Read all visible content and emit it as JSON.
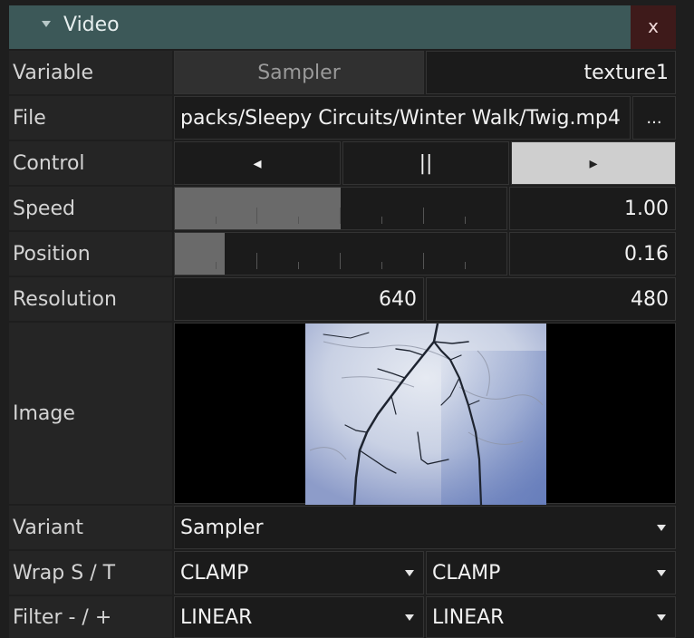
{
  "panel": {
    "title": "Video",
    "close_label": "x"
  },
  "rows": {
    "variable": {
      "label": "Variable",
      "sampler_button": "Sampler",
      "value": "texture1"
    },
    "file": {
      "label": "File",
      "path": "packs/Sleepy Circuits/Winter Walk/Twig.mp4",
      "browse_label": "..."
    },
    "control": {
      "label": "Control",
      "prev": "◂",
      "pause": "||",
      "play": "▸",
      "active": "play"
    },
    "speed": {
      "label": "Speed",
      "value": "1.00",
      "fill_fraction": 0.5
    },
    "position": {
      "label": "Position",
      "value": "0.16",
      "fill_fraction": 0.15
    },
    "resolution": {
      "label": "Resolution",
      "width": "640",
      "height": "480"
    },
    "image": {
      "label": "Image"
    },
    "variant": {
      "label": "Variant",
      "value": "Sampler"
    },
    "wrap": {
      "label": "Wrap S / T",
      "s": "CLAMP",
      "t": "CLAMP"
    },
    "filter": {
      "label": "Filter - / +",
      "min": "LINEAR",
      "mag": "LINEAR"
    }
  },
  "colors": {
    "title_bar": "#3c5858",
    "close_button": "#3e1a1a",
    "slider_fill": "#6a6a6a",
    "active_button": "#cfcfcf"
  }
}
